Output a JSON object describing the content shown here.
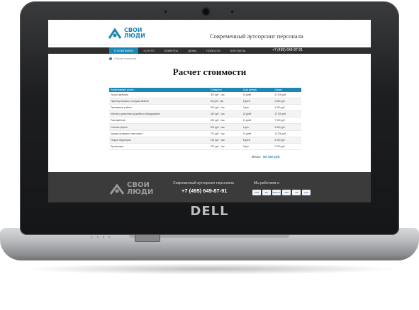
{
  "device": {
    "brand": "DELL"
  },
  "site": {
    "logo_line1": "СВОИ",
    "logo_line2": "ЛЮДИ",
    "tagline": "Современный аутсорсинг персонала",
    "nav": [
      "О компании",
      "Услуги",
      "Клиенты",
      "Цены",
      "Новости",
      "Контакты"
    ],
    "nav_phone": "+7 (495) 649-87-91",
    "breadcrumb": "> Расчет стоимости",
    "title": "Расчет стоимости",
    "table": {
      "headers": [
        "Наименование услуги",
        "Стоимость",
        "Срок аренды",
        "Сумма"
      ],
      "rows": [
        [
          "Услуги грузчиков",
          "300 руб. / час",
          "10 дней",
          "22 000 руб."
        ],
        [
          "Транспортировка и погрузка мебели",
          "90 руб. / час",
          "5 дней",
          "2 800 руб."
        ],
        [
          "Такелажные работы",
          "200 руб. / час",
          "3 дня",
          "4 000 руб."
        ],
        [
          "Монтаж и демонтаж оружейного оборудования",
          "340 руб. / час",
          "20 дней",
          "12 000 руб."
        ],
        [
          "Разнорабочие",
          "260 руб. / час",
          "10 дней",
          "7 300 руб."
        ],
        [
          "Уличная уборка",
          "300 руб. / час",
          "4 дня",
          "4 500 руб."
        ],
        [
          "Аренда складского персонала",
          "270 руб. / час",
          "10 дней",
          "13 000 руб."
        ],
        [
          "Уборка территории",
          "150 руб. / час",
          "5 дней",
          "4 000 руб."
        ],
        [
          "Промоутеры",
          "230 руб. / час",
          "3 дня",
          "2 000 руб."
        ]
      ]
    },
    "total_label": "Итого:",
    "total_value": "50 720 руб.",
    "footer": {
      "logo_line1": "СВОИ",
      "logo_line2": "ЛЮДИ",
      "tagline": "Современный аутсорсинг персонала",
      "phone": "+7 (495) 649-87-91",
      "pay_title": "Мы работаем с:",
      "pay_icons": [
        "VISA",
        "MC",
        "Maestro",
        "WM",
        "YM",
        "Qiwi"
      ]
    }
  },
  "colors": {
    "accent": "#1c87b6",
    "nav_bg": "#2f2f2f",
    "footer_bg": "#3b3b3b"
  }
}
